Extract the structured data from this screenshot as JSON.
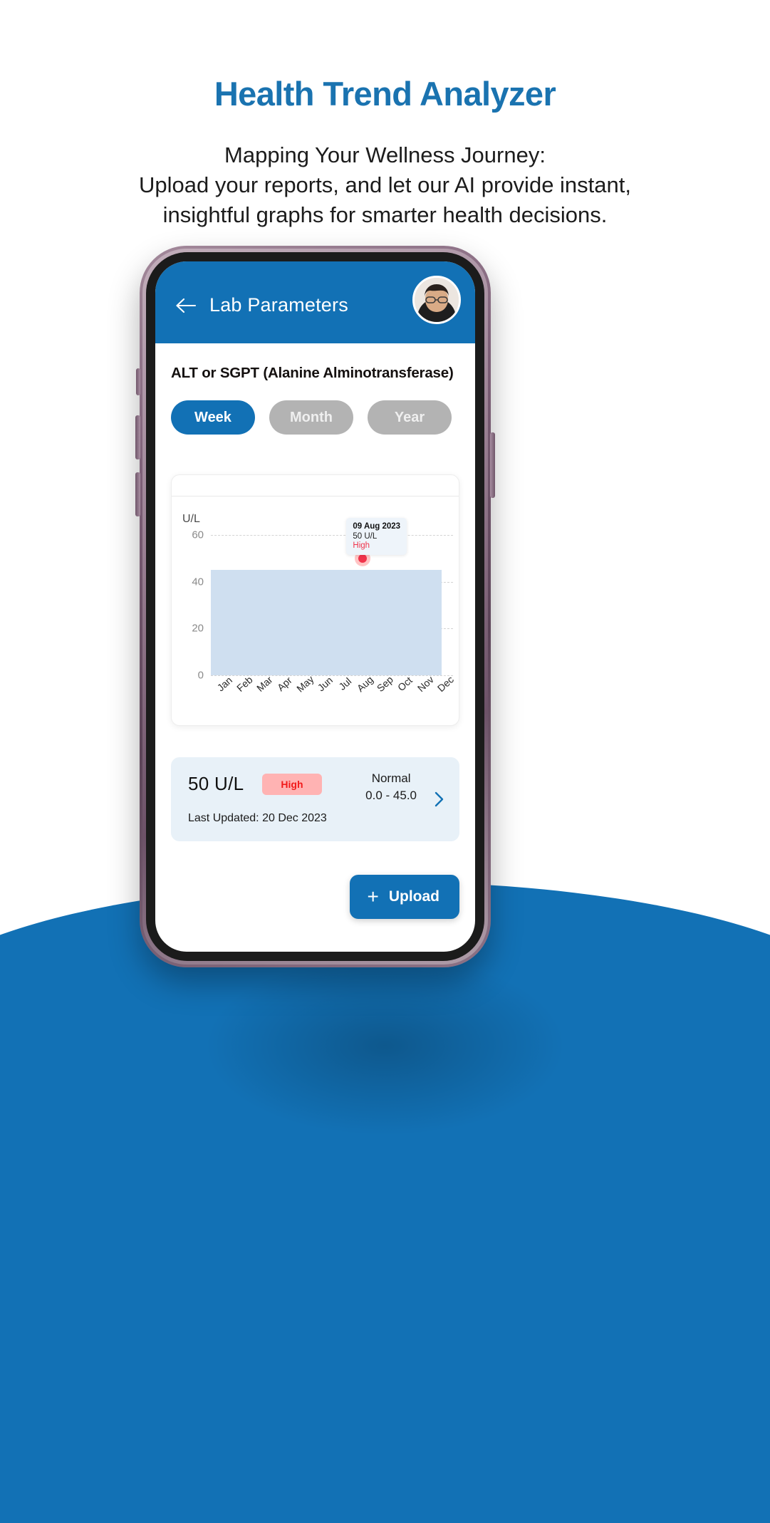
{
  "hero": {
    "title": "Health Trend Analyzer",
    "subtitle_line1": "Mapping Your Wellness Journey:",
    "subtitle_line2": "Upload your reports, and let our AI provide instant,",
    "subtitle_line3": "insightful graphs for smarter health decisions.",
    "title_color": "#1a73b0"
  },
  "app": {
    "header": {
      "back_icon": "arrow-left-icon",
      "title": "Lab Parameters",
      "avatar_alt": "user-avatar",
      "bg_color": "#1271b5"
    },
    "parameter_name": "ALT or SGPT (Alanine Alminotransferase)",
    "tabs": [
      {
        "label": "Week",
        "active": true
      },
      {
        "label": "Month",
        "active": false
      },
      {
        "label": "Year",
        "active": false
      }
    ],
    "result": {
      "value": "50 U/L",
      "status_badge": "High",
      "status_color": "#f11b1b",
      "status_bg": "#ffb3b3",
      "normal_title": "Normal",
      "normal_range": "0.0 - 45.0",
      "last_updated": "Last Updated: 20 Dec 2023",
      "chevron_icon": "chevron-right-icon"
    },
    "upload_button": {
      "plus_icon": "plus-icon",
      "label": "Upload"
    }
  },
  "chart_data": {
    "type": "area",
    "title": "",
    "unit_label": "U/L",
    "ylabel": "U/L",
    "xlabel": "",
    "categories": [
      "Jan",
      "Feb",
      "Mar",
      "Apr",
      "May",
      "Jun",
      "Jul",
      "Aug",
      "Sep",
      "Oct",
      "Nov",
      "Dec"
    ],
    "yticks": [
      0,
      20,
      40,
      60
    ],
    "ylim": [
      0,
      60
    ],
    "reference_band": {
      "label": "Normal range band",
      "from": 0,
      "to": 45,
      "color": "#cfdff0"
    },
    "points": [
      {
        "x": "Aug",
        "date": "09 Aug 2023",
        "value": 50,
        "unit": "U/L",
        "status": "High",
        "color": "#f0334b"
      }
    ],
    "tooltip": {
      "date": "09 Aug 2023",
      "value": "50 U/L",
      "status": "High",
      "bg": "#eef4fa"
    },
    "grid": true,
    "legend": "none"
  }
}
